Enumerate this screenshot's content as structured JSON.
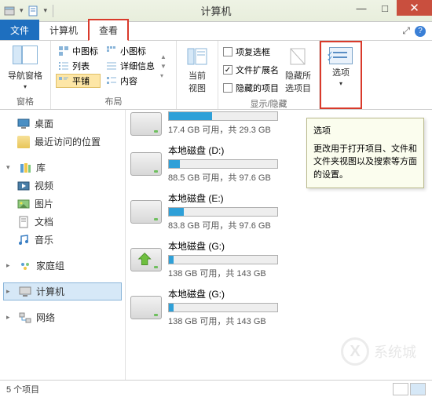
{
  "window": {
    "title": "计算机"
  },
  "tabs": {
    "file": "文件",
    "computer": "计算机",
    "view": "查看"
  },
  "ribbon": {
    "nav_pane": "导航窗格",
    "panes_label": "窗格",
    "layout": {
      "medium_icons": "中图标",
      "small_icons": "小图标",
      "list": "列表",
      "details": "详细信息",
      "tiles": "平铺",
      "content": "内容",
      "label": "布局"
    },
    "current_view": {
      "btn": "当前\n视图",
      "label": ""
    },
    "showhide": {
      "checkboxes": "项复选框",
      "extensions": "文件扩展名",
      "hidden_items": "隐藏的项目",
      "hide_selected": "隐藏所\n选项目",
      "label": "显示/隐藏"
    },
    "options": {
      "btn": "选项"
    }
  },
  "tooltip": {
    "title": "选项",
    "body": "更改用于打开项目、文件和文件夹视图以及搜索等方面的设置。"
  },
  "sidebar": {
    "desktop": "桌面",
    "recent": "最近访问的位置",
    "libraries": "库",
    "videos": "视频",
    "pictures": "图片",
    "documents": "文档",
    "music": "音乐",
    "homegroup": "家庭组",
    "computer": "计算机",
    "network": "网络"
  },
  "drives": [
    {
      "name": "",
      "info": "17.4 GB 可用，共 29.3 GB",
      "fill": 40
    },
    {
      "name": "本地磁盘 (D:)",
      "info": "88.5 GB 可用，共 97.6 GB",
      "fill": 10
    },
    {
      "name": "本地磁盘 (E:)",
      "info": "83.8 GB 可用，共 97.6 GB",
      "fill": 14
    },
    {
      "name": "本地磁盘 (G:)",
      "info": "138 GB 可用，共 143 GB",
      "fill": 4,
      "arrow": true
    },
    {
      "name": "本地磁盘 (G:)",
      "info": "138 GB 可用，共 143 GB",
      "fill": 4
    }
  ],
  "status": {
    "count": "5 个项目"
  },
  "colors": {
    "accent": "#1e6fbf",
    "highlight": "#d93a2b"
  }
}
